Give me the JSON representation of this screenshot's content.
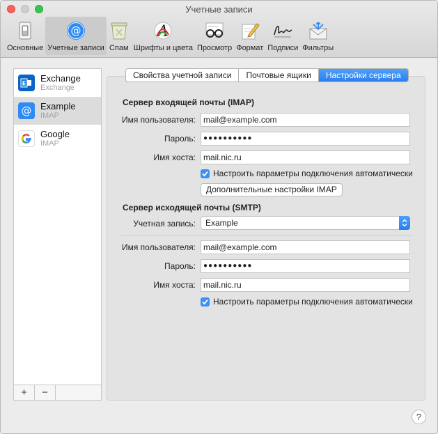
{
  "window": {
    "title": "Учетные записи"
  },
  "toolbar": {
    "items": [
      {
        "label": "Основные",
        "icon": "switch-icon"
      },
      {
        "label": "Учетные записи",
        "icon": "at-icon"
      },
      {
        "label": "Спам",
        "icon": "trash-icon"
      },
      {
        "label": "Шрифты и цвета",
        "icon": "font-icon"
      },
      {
        "label": "Просмотр",
        "icon": "glasses-icon"
      },
      {
        "label": "Формат",
        "icon": "pencil-icon"
      },
      {
        "label": "Подписи",
        "icon": "signature-icon"
      },
      {
        "label": "Фильтры",
        "icon": "filter-envelope-icon"
      }
    ]
  },
  "sidebar": {
    "accounts": [
      {
        "name": "Exchange",
        "type": "Exchange"
      },
      {
        "name": "Example",
        "type": "IMAP"
      },
      {
        "name": "Google",
        "type": "IMAP"
      }
    ],
    "add_label": "+",
    "remove_label": "−"
  },
  "tabs": [
    "Свойства учетной записи",
    "Почтовые ящики",
    "Настройки сервера"
  ],
  "incoming": {
    "title": "Сервер входящей почты (IMAP)",
    "username_label": "Имя пользователя:",
    "username": "mail@example.com",
    "password_label": "Пароль:",
    "password": "●●●●●●●●●●",
    "host_label": "Имя хоста:",
    "host": "mail.nic.ru",
    "auto_label": "Настроить параметры подключения автоматически",
    "advanced_label": "Дополнительные настройки IMAP"
  },
  "outgoing": {
    "title": "Сервер исходящей почты (SMTP)",
    "account_label": "Учетная запись:",
    "account": "Example",
    "username_label": "Имя пользователя:",
    "username": "mail@example.com",
    "password_label": "Пароль:",
    "password": "●●●●●●●●●●",
    "host_label": "Имя хоста:",
    "host": "mail.nic.ru",
    "auto_label": "Настроить параметры подключения автоматически"
  },
  "help_label": "?"
}
